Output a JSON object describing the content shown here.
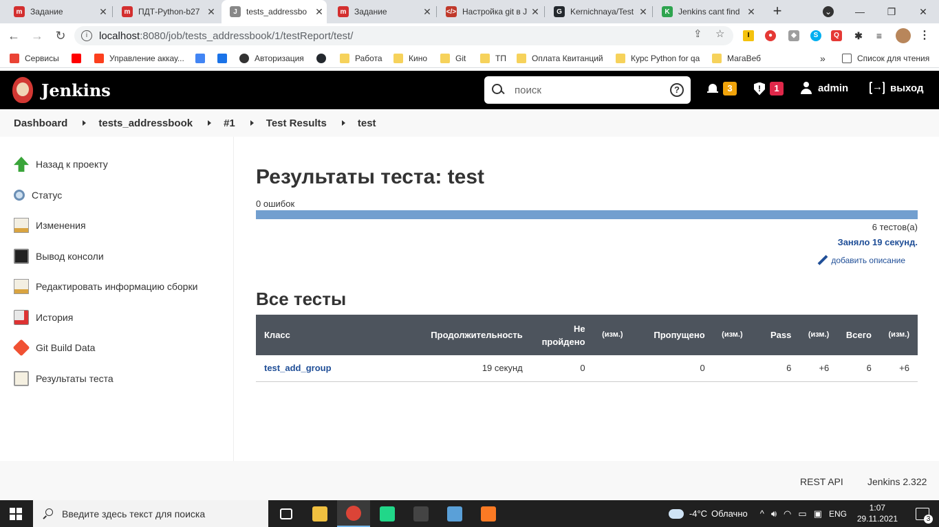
{
  "browser": {
    "tabs": [
      {
        "title": "Задание",
        "icon": "stepik-icon",
        "color": "#d32f2f",
        "glyph": "m"
      },
      {
        "title": "ПДТ-Python-b27",
        "icon": "stepik-icon",
        "color": "#d32f2f",
        "glyph": "m"
      },
      {
        "title": "tests_addressbo",
        "icon": "jenkins-icon",
        "color": "#888888",
        "glyph": "J",
        "active": true
      },
      {
        "title": "Задание",
        "icon": "stepik-icon",
        "color": "#d32f2f",
        "glyph": "m"
      },
      {
        "title": "Настройка git в J",
        "icon": "code-icon",
        "color": "#c0392b",
        "glyph": "</>"
      },
      {
        "title": "Kernichnaya/Test",
        "icon": "github-icon",
        "color": "#24292e",
        "glyph": "G"
      },
      {
        "title": "Jenkins cant find",
        "icon": "kaggle-icon",
        "color": "#2ea44f",
        "glyph": "K"
      }
    ],
    "new_tab": "+",
    "window_controls": {
      "dropdown": "⌄",
      "minimize": "—",
      "restore": "❐",
      "close": "✕"
    },
    "nav": {
      "back": "←",
      "forward": "→",
      "reload": "↻"
    },
    "url_host": "localhost",
    "url_path": ":8080/job/tests_addressbook/1/testReport/test/",
    "bookmarks": [
      {
        "label": "Сервисы",
        "icon": "apps-grid-icon",
        "type": "apps"
      },
      {
        "label": "",
        "icon": "youtube-icon",
        "type": "youtube"
      },
      {
        "label": "Управление аккау...",
        "icon": "yandex-icon",
        "type": "yandex"
      },
      {
        "label": "",
        "icon": "google-translate-icon",
        "type": "translate"
      },
      {
        "label": "",
        "icon": "chat-icon",
        "type": "chat"
      },
      {
        "label": "Авторизация",
        "icon": "globe-icon",
        "type": "globe"
      },
      {
        "label": "",
        "icon": "github-icon",
        "type": "github"
      },
      {
        "label": "Работа",
        "icon": "folder-icon",
        "type": "folder"
      },
      {
        "label": "Кино",
        "icon": "folder-icon",
        "type": "folder"
      },
      {
        "label": "Git",
        "icon": "folder-icon",
        "type": "folder"
      },
      {
        "label": "ТП",
        "icon": "folder-icon",
        "type": "folder"
      },
      {
        "label": "Оплата Квитанций",
        "icon": "folder-icon",
        "type": "folder"
      },
      {
        "label": "Курс Python for qa",
        "icon": "folder-icon",
        "type": "folder"
      },
      {
        "label": "МагаВеб",
        "icon": "folder-icon",
        "type": "folder"
      }
    ],
    "bookmarks_more": "»",
    "reading_list": "Список для чтения"
  },
  "jenkins": {
    "brand": "Jenkins",
    "search_placeholder": "поиск",
    "help": "?",
    "notifications_count": "3",
    "security_count": "1",
    "user": "admin",
    "logout": "выход",
    "colors": {
      "notif_badge": "#f0a30a",
      "security_badge": "#e0284a",
      "link": "#1f4e97",
      "progress": "#729fcf",
      "table_header": "#4d545d"
    }
  },
  "breadcrumb": [
    "Dashboard",
    "tests_addressbook",
    "#1",
    "Test Results",
    "test"
  ],
  "side_panel": [
    {
      "label": "Назад к проекту",
      "icon": "up-arrow-icon"
    },
    {
      "label": "Статус",
      "icon": "magnifier-icon"
    },
    {
      "label": "Изменения",
      "icon": "notepad-icon"
    },
    {
      "label": "Вывод консоли",
      "icon": "terminal-icon"
    },
    {
      "label": "Редактировать информацию сборки",
      "icon": "notepad-edit-icon"
    },
    {
      "label": "История",
      "icon": "history-icon"
    },
    {
      "label": "Git Build Data",
      "icon": "git-icon"
    },
    {
      "label": "Результаты теста",
      "icon": "clipboard-icon"
    }
  ],
  "report": {
    "title": "Результаты теста: test",
    "failures": "0 ошибок",
    "pass_fraction": 1.0,
    "test_count": "6 тестов(а)",
    "took": "Заняло 19 секунд.",
    "add_description": "добавить описание",
    "all_tests_title": "Все тесты",
    "table": {
      "headers": [
        {
          "label": "Класс",
          "small": false
        },
        {
          "label": "Продолжительность",
          "small": false
        },
        {
          "label": "Не пройдено",
          "small": false
        },
        {
          "label": "(изм.)",
          "small": true
        },
        {
          "label": "Пропущено",
          "small": false
        },
        {
          "label": "(изм.)",
          "small": true
        },
        {
          "label": "Pass",
          "small": false
        },
        {
          "label": "(изм.)",
          "small": true
        },
        {
          "label": "Всего",
          "small": false
        },
        {
          "label": "(изм.)",
          "small": true
        }
      ],
      "rows": [
        [
          "test_add_group",
          "19 секунд",
          "0",
          "",
          "0",
          "",
          "6",
          "+6",
          "6",
          "+6"
        ]
      ]
    }
  },
  "footer": {
    "rest_api": "REST API",
    "version": "Jenkins 2.322"
  },
  "taskbar": {
    "search_placeholder": "Введите здесь текст для поиска",
    "apps": [
      {
        "name": "task-view-icon",
        "color": "#ffffff"
      },
      {
        "name": "file-explorer-icon",
        "color": "#f0c040"
      },
      {
        "name": "chrome-icon",
        "color": "#db4437",
        "active": true
      },
      {
        "name": "pycharm-icon",
        "color": "#21d789"
      },
      {
        "name": "terminal-app-icon",
        "color": "#444444"
      },
      {
        "name": "notepad-app-icon",
        "color": "#5aa0d8"
      },
      {
        "name": "xampp-icon",
        "color": "#fb7a24"
      }
    ],
    "weather_temp": "-4°C",
    "weather_text": "Облачно",
    "lang": "ENG",
    "time": "1:07",
    "date": "29.11.2021",
    "notifications": "3"
  }
}
